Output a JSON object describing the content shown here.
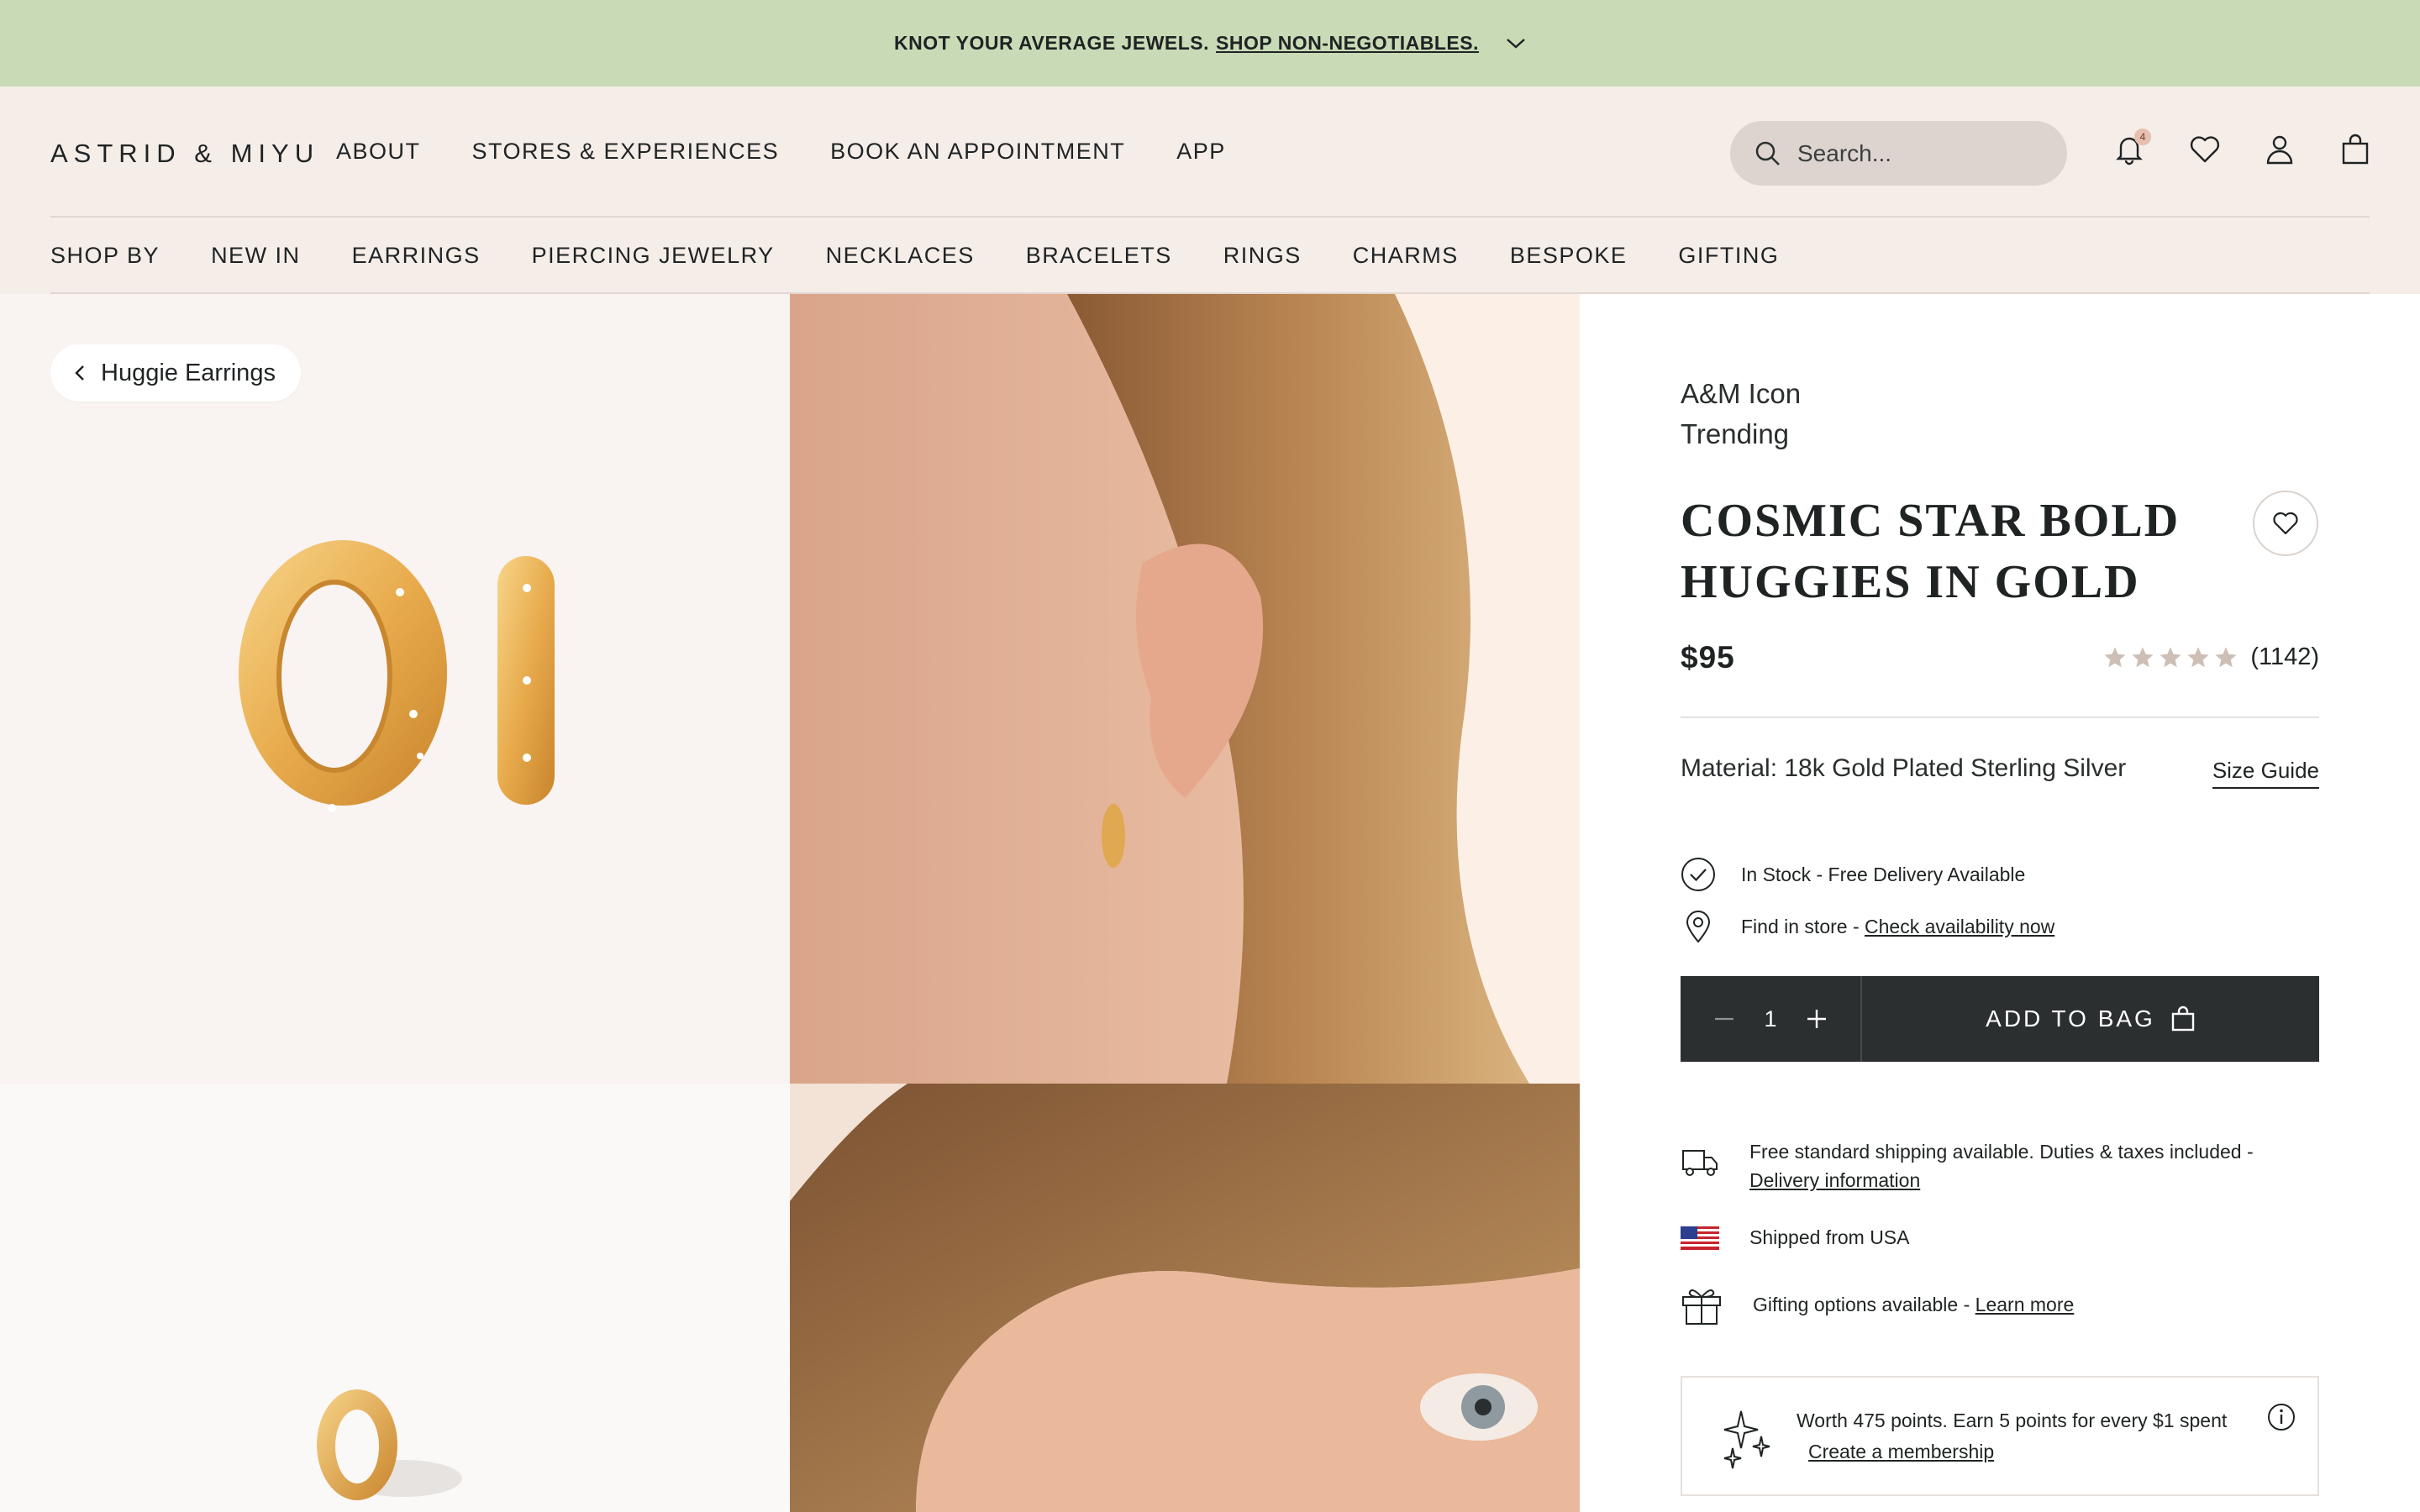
{
  "announcement": {
    "text": "KNOT YOUR AVERAGE JEWELS.",
    "link": "SHOP NON-NEGOTIABLES."
  },
  "header": {
    "logo": "ASTRID & MIYU",
    "top_nav": [
      "ABOUT",
      "STORES & EXPERIENCES",
      "BOOK AN APPOINTMENT",
      "APP"
    ],
    "search_placeholder": "Search...",
    "notification_count": "4",
    "category_nav": [
      "SHOP BY",
      "NEW IN",
      "EARRINGS",
      "PIERCING JEWELRY",
      "NECKLACES",
      "BRACELETS",
      "RINGS",
      "CHARMS",
      "BESPOKE",
      "GIFTING"
    ]
  },
  "breadcrumb": {
    "label": "Huggie Earrings"
  },
  "product": {
    "tags": [
      "A&M Icon",
      "Trending"
    ],
    "title": "COSMIC STAR BOLD HUGGIES IN GOLD",
    "price": "$95",
    "rating": 5,
    "review_count": "(1142)",
    "material": "Material: 18k Gold Plated Sterling Silver",
    "size_guide": "Size Guide",
    "stock": "In Stock - Free Delivery Available",
    "find_in_store": "Find in store -",
    "check_availability": "Check availability now",
    "quantity": "1",
    "add_to_bag": "ADD TO BAG"
  },
  "perks": {
    "shipping": "Free standard shipping available. Duties & taxes included -",
    "delivery_link": "Delivery information",
    "shipped_from": "Shipped from USA",
    "gifting": "Gifting options available -",
    "gifting_link": "Learn more",
    "points": "Worth 475 points. Earn 5 points for every $1 spent",
    "membership_link": "Create a membership"
  },
  "colors": {
    "announcement_bg": "#c9dbb6",
    "header_bg": "#f5ede8",
    "button_dark": "#2b2f30",
    "star_color": "#cdbfb5"
  }
}
